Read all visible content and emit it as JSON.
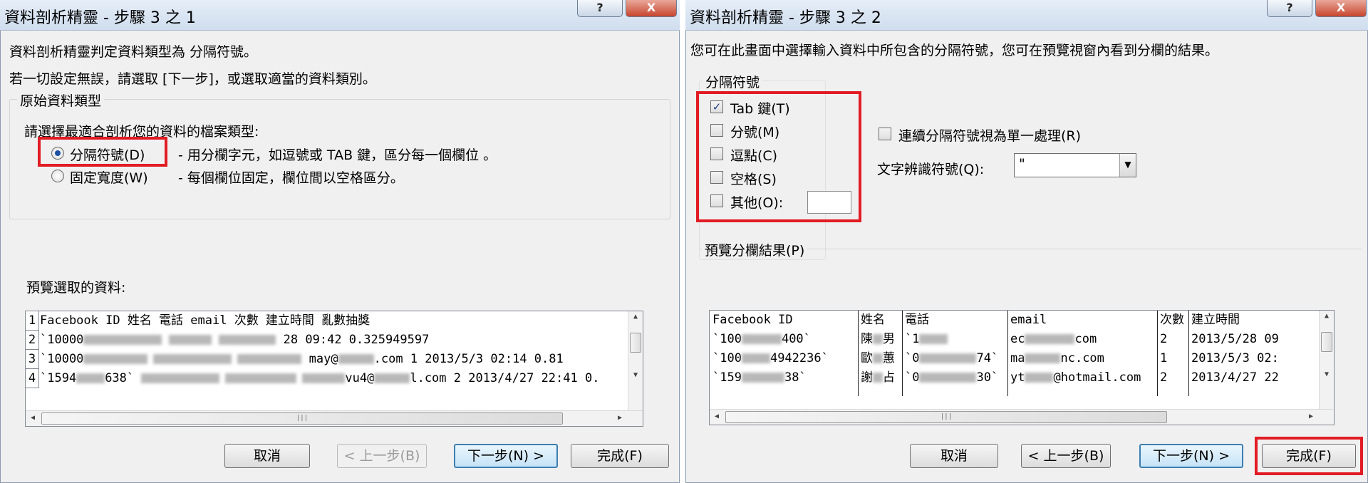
{
  "left_dialog": {
    "title": "資料剖析精靈 - 步驟 3 之 1",
    "help_label": "?",
    "close_label": "X",
    "intro_line1": "資料剖析精靈判定資料類型為 分隔符號。",
    "intro_line2": "若一切設定無誤，請選取 [下一步]，或選取適當的資料類別。",
    "group_label": "原始資料類型",
    "prompt": "請選擇最適合剖析您的資料的檔案類型:",
    "option_delimited": "分隔符號(D)",
    "option_delimited_desc": "- 用分欄字元，如逗號或 TAB 鍵，區分每一個欄位 。",
    "option_fixed": "固定寬度(W)",
    "option_fixed_desc": "- 每個欄位固定，欄位間以空格區分。",
    "selected_option": "分隔符號(D)",
    "preview_label": "預覽選取的資料:",
    "preview_rows": [
      {
        "num": "1",
        "a": "Facebook ID 姓名 電話 email 次數 建立時間 亂數抽獎",
        "b": ""
      },
      {
        "num": "2",
        "a": "`10000",
        "b": "28 09:42 0.325949597"
      },
      {
        "num": "3",
        "a": "`10000",
        "b": "may@",
        "c": ".com 1 2013/5/3 02:14 0.81"
      },
      {
        "num": "4",
        "a": "`1594",
        "b": "638`",
        "c": "vu4@",
        "d": "l.com 2 2013/4/27 22:41 0."
      }
    ],
    "buttons": {
      "cancel": "取消",
      "back": "< 上一步(B)",
      "next": "下一步(N) >",
      "finish": "完成(F)"
    }
  },
  "right_dialog": {
    "title": "資料剖析精靈 - 步驟 3 之 2",
    "help_label": "?",
    "close_label": "X",
    "intro": "您可在此畫面中選擇輸入資料中所包含的分隔符號，您可在預覽視窗內看到分欄的結果。",
    "delimiter_group_label": "分隔符號",
    "delimiters": {
      "tab": {
        "label": "Tab 鍵(T)",
        "checked": true
      },
      "semicolon": {
        "label": "分號(M)",
        "checked": false
      },
      "comma": {
        "label": "逗點(C)",
        "checked": false
      },
      "space": {
        "label": "空格(S)",
        "checked": false
      },
      "other": {
        "label": "其他(O):",
        "checked": false,
        "value": ""
      }
    },
    "consecutive_label": "連續分隔符號視為單一處理(R)",
    "consecutive_checked": false,
    "qualifier_label": "文字辨識符號(Q):",
    "qualifier_value": "\"",
    "preview_label": "預覽分欄結果(P)",
    "preview_columns": [
      [
        "Facebook ID",
        "`100",
        "`100",
        "`159"
      ],
      [
        "姓名",
        "陳",
        "歐",
        "謝"
      ],
      [
        "電話",
        "`1",
        "`0",
        "`0"
      ],
      [
        "email",
        "ec",
        "ma",
        "yt"
      ],
      [
        "次數",
        "2",
        "1",
        "2"
      ],
      [
        "建立時間",
        "2013/5/28 09",
        "2013/5/3 02:",
        "2013/4/27 22"
      ]
    ],
    "preview_fragments": {
      "r1c1": "400`",
      "r2c1": "4942236`",
      "r3c1": "38`",
      "r1c2": "男",
      "r2c2": "蕙",
      "r3c2": "占",
      "r2c3": "74`",
      "r3c3": "30`",
      "r1c4": "com",
      "r2c4": "nc.com",
      "r3c4": "@hotmail.com"
    },
    "buttons": {
      "cancel": "取消",
      "back": "< 上一步(B)",
      "next": "下一步(N) >",
      "finish": "完成(F)"
    }
  },
  "colors": {
    "highlight": "#e21c24",
    "dialog_bg": "#f0f0f0",
    "radio_dot": "#1d4fa3"
  },
  "icons": [
    "help-icon",
    "close-icon",
    "checkmark-icon",
    "dropdown-arrow-icon",
    "scroll-up-icon",
    "scroll-down-icon",
    "scroll-left-icon",
    "scroll-right-icon"
  ]
}
